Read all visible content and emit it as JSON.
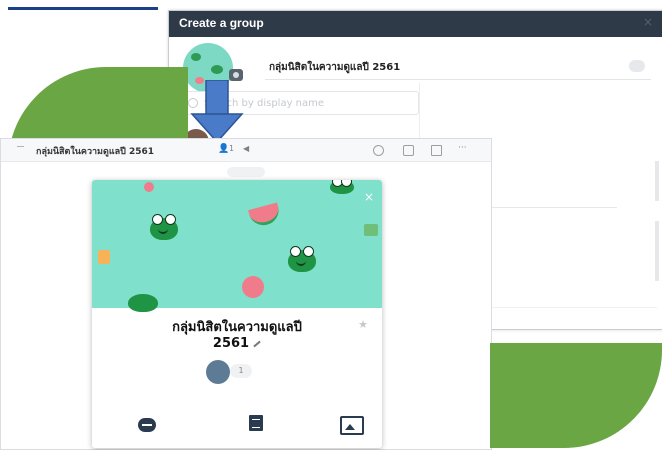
{
  "dialog": {
    "title": "Create a group",
    "group_name": "กลุ่มนิสิตในความดูแลปี 2561",
    "name_counter": "",
    "search_placeholder": "Search by display name",
    "right_hint": "",
    "close_glyph": "×"
  },
  "chat": {
    "title": "กลุ่มนิสิตในความดูแลปี 2561",
    "member_count": "1",
    "more_glyph": "···"
  },
  "card": {
    "name_line1": "กลุ่มนิสิตในความดูแลปี",
    "name_line2": "2561",
    "member_badge": "1",
    "close_glyph": "×",
    "star_glyph": "★"
  },
  "icons": {
    "back": "back-icon",
    "member": "person-icon",
    "mute": "speaker-icon",
    "search": "search-icon",
    "call": "call-icon",
    "notes": "notes-icon",
    "more": "more-icon",
    "chat": "chat-icon",
    "note_list": "notes-icon",
    "album": "album-icon"
  },
  "colors": {
    "dialog_titlebar": "#2f3a48",
    "accent_green": "#6aa744",
    "cover": "#7fe0cc",
    "arrow": "#4a7bc8"
  }
}
